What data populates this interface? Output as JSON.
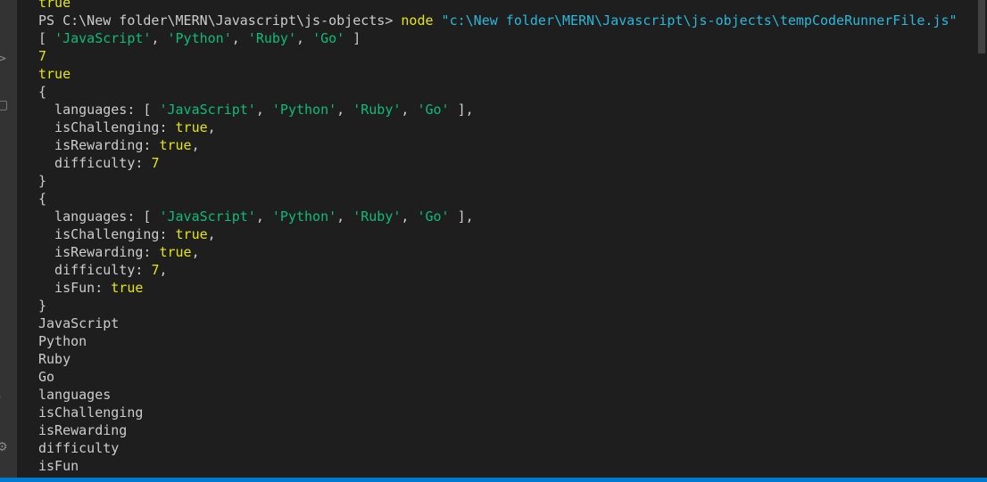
{
  "colors": {
    "background": "#1e1e1e",
    "default": "#cccccc",
    "yellow": "#e5e510",
    "green": "#0dbc79",
    "cyan": "#29b8db",
    "status_bar": "#007acc"
  },
  "activity_bar": {
    "icons": [
      {
        "name": "chevron-right-icon",
        "glyph": ">"
      },
      {
        "name": "copy-icon",
        "glyph": "▢"
      },
      {
        "name": "account-icon",
        "glyph": ")"
      },
      {
        "name": "gear-icon",
        "glyph": "⚙"
      }
    ]
  },
  "terminal": {
    "lines": [
      [
        {
          "t": "true",
          "c": "yellow"
        }
      ],
      [
        {
          "t": "PS C:\\New folder\\MERN\\Javascript\\js-objects> ",
          "c": "default"
        },
        {
          "t": "node",
          "c": "yellow"
        },
        {
          "t": " ",
          "c": "default"
        },
        {
          "t": "\"c:\\New folder\\MERN\\Javascript\\js-objects\\tempCodeRunnerFile.js\"",
          "c": "cyan"
        }
      ],
      [
        {
          "t": "[ ",
          "c": "default"
        },
        {
          "t": "'JavaScript'",
          "c": "green"
        },
        {
          "t": ", ",
          "c": "default"
        },
        {
          "t": "'Python'",
          "c": "green"
        },
        {
          "t": ", ",
          "c": "default"
        },
        {
          "t": "'Ruby'",
          "c": "green"
        },
        {
          "t": ", ",
          "c": "default"
        },
        {
          "t": "'Go'",
          "c": "green"
        },
        {
          "t": " ]",
          "c": "default"
        }
      ],
      [
        {
          "t": "7",
          "c": "yellow"
        }
      ],
      [
        {
          "t": "true",
          "c": "yellow"
        }
      ],
      [
        {
          "t": "{",
          "c": "default"
        }
      ],
      [
        {
          "t": "  languages: [ ",
          "c": "default"
        },
        {
          "t": "'JavaScript'",
          "c": "green"
        },
        {
          "t": ", ",
          "c": "default"
        },
        {
          "t": "'Python'",
          "c": "green"
        },
        {
          "t": ", ",
          "c": "default"
        },
        {
          "t": "'Ruby'",
          "c": "green"
        },
        {
          "t": ", ",
          "c": "default"
        },
        {
          "t": "'Go'",
          "c": "green"
        },
        {
          "t": " ],",
          "c": "default"
        }
      ],
      [
        {
          "t": "  isChallenging: ",
          "c": "default"
        },
        {
          "t": "true",
          "c": "yellow"
        },
        {
          "t": ",",
          "c": "default"
        }
      ],
      [
        {
          "t": "  isRewarding: ",
          "c": "default"
        },
        {
          "t": "true",
          "c": "yellow"
        },
        {
          "t": ",",
          "c": "default"
        }
      ],
      [
        {
          "t": "  difficulty: ",
          "c": "default"
        },
        {
          "t": "7",
          "c": "yellow"
        }
      ],
      [
        {
          "t": "}",
          "c": "default"
        }
      ],
      [
        {
          "t": "{",
          "c": "default"
        }
      ],
      [
        {
          "t": "  languages: [ ",
          "c": "default"
        },
        {
          "t": "'JavaScript'",
          "c": "green"
        },
        {
          "t": ", ",
          "c": "default"
        },
        {
          "t": "'Python'",
          "c": "green"
        },
        {
          "t": ", ",
          "c": "default"
        },
        {
          "t": "'Ruby'",
          "c": "green"
        },
        {
          "t": ", ",
          "c": "default"
        },
        {
          "t": "'Go'",
          "c": "green"
        },
        {
          "t": " ],",
          "c": "default"
        }
      ],
      [
        {
          "t": "  isChallenging: ",
          "c": "default"
        },
        {
          "t": "true",
          "c": "yellow"
        },
        {
          "t": ",",
          "c": "default"
        }
      ],
      [
        {
          "t": "  isRewarding: ",
          "c": "default"
        },
        {
          "t": "true",
          "c": "yellow"
        },
        {
          "t": ",",
          "c": "default"
        }
      ],
      [
        {
          "t": "  difficulty: ",
          "c": "default"
        },
        {
          "t": "7",
          "c": "yellow"
        },
        {
          "t": ",",
          "c": "default"
        }
      ],
      [
        {
          "t": "  isFun: ",
          "c": "default"
        },
        {
          "t": "true",
          "c": "yellow"
        }
      ],
      [
        {
          "t": "}",
          "c": "default"
        }
      ],
      [
        {
          "t": "JavaScript",
          "c": "default"
        }
      ],
      [
        {
          "t": "Python",
          "c": "default"
        }
      ],
      [
        {
          "t": "Ruby",
          "c": "default"
        }
      ],
      [
        {
          "t": "Go",
          "c": "default"
        }
      ],
      [
        {
          "t": "languages",
          "c": "default"
        }
      ],
      [
        {
          "t": "isChallenging",
          "c": "default"
        }
      ],
      [
        {
          "t": "isRewarding",
          "c": "default"
        }
      ],
      [
        {
          "t": "difficulty",
          "c": "default"
        }
      ],
      [
        {
          "t": "isFun",
          "c": "default"
        }
      ]
    ]
  }
}
